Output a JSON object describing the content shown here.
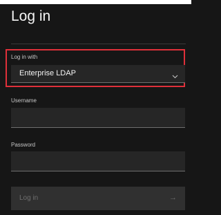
{
  "page": {
    "title": "Log in"
  },
  "login_method": {
    "label": "Log in with",
    "selected": "Enterprise LDAP"
  },
  "username": {
    "label": "Username",
    "value": ""
  },
  "password": {
    "label": "Password",
    "value": ""
  },
  "submit": {
    "label": "Log in",
    "arrow": "→"
  },
  "colors": {
    "background": "#161616",
    "field": "#262626",
    "highlight": "#e0303a",
    "button_disabled": "#303030"
  },
  "icons": {
    "select_chevron": "chevron-down-icon",
    "submit_arrow": "arrow-right-icon"
  }
}
